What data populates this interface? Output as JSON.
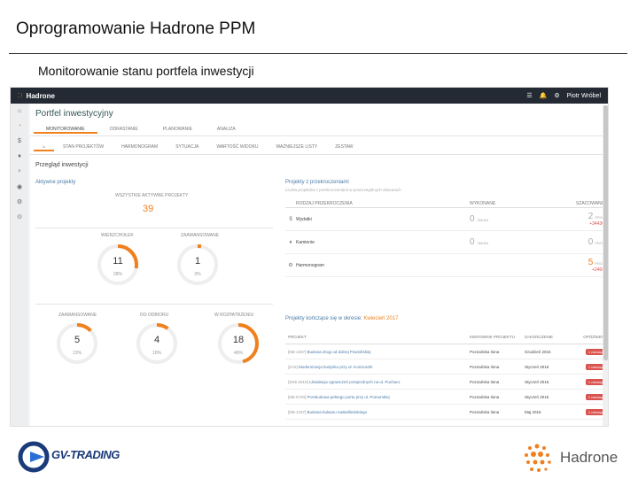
{
  "slide": {
    "title": "Oprogramowanie Hadrone PPM",
    "subtitle": "Monitorowanie stanu portfela inwestycji"
  },
  "app": {
    "brand": "Hadrone",
    "user": "Piotr Wróbel"
  },
  "page": {
    "title": "Portfel inwestycyjny",
    "tabs": [
      {
        "label": "MONITOROWANIE",
        "active": true
      },
      {
        "label": "ODRASTANIE",
        "active": false
      },
      {
        "label": "PLANOWANIE",
        "active": false
      },
      {
        "label": "ANALIZA",
        "active": false
      }
    ],
    "subtabs": [
      {
        "label": "",
        "home": true
      },
      {
        "label": "STAN PROJEKTÓW"
      },
      {
        "label": "HARMONOGRAM"
      },
      {
        "label": "SYTUACJA"
      },
      {
        "label": "WARTOŚĆ WIDOKU"
      },
      {
        "label": "WAŻNIEJSZE LISTY"
      },
      {
        "label": "ZESTAW"
      }
    ],
    "section_title": "Przegląd inwestycji"
  },
  "active_projects": {
    "heading": "Aktywne projekty",
    "total_label": "WSZYSTKIE AKTYWNE PROJEKTY",
    "total": "39",
    "groups": [
      {
        "label": "WIERZCHOŁEK",
        "value": "11",
        "pct": "28%",
        "fraction": 0.28
      },
      {
        "label": "ZAAWANSOWANE",
        "value": "1",
        "pct": "3%",
        "fraction": 0.03
      },
      {
        "label": "ZAAWANSOWANE",
        "value": "5",
        "pct": "13%",
        "fraction": 0.13
      },
      {
        "label": "DO ODBIORU",
        "value": "4",
        "pct": "10%",
        "fraction": 0.1
      },
      {
        "label": "W ROZPATRZENIU",
        "value": "18",
        "pct": "46%",
        "fraction": 0.46
      }
    ]
  },
  "overdue": {
    "heading": "Projekty z przekroczeniami",
    "subheading": "Liczba projektów z przekroczeniami w poszczególnych obszarach",
    "columns": [
      "RODZAJ PRZEKROCZENIA",
      "WYKONANE",
      "SZACOWANE"
    ],
    "rows": [
      {
        "icon": "$",
        "name": "Wydatki",
        "done": "0",
        "done_unit": "ZMIAN",
        "plan": "2",
        "plan_unit": "PROJ",
        "plan_highlight": false,
        "delta": "+34436"
      },
      {
        "icon": "♦",
        "name": "Kamienie",
        "done": "0",
        "done_unit": "ZMIAN",
        "plan": "0",
        "plan_unit": "PROJ",
        "plan_highlight": false,
        "delta": ""
      },
      {
        "icon": "⚙",
        "name": "Harmonogram",
        "done": "",
        "done_unit": "",
        "plan": "5",
        "plan_unit": "PROJ",
        "plan_highlight": true,
        "delta": "+2460"
      }
    ]
  },
  "closing": {
    "heading": "Projekty kończące się w okresie:",
    "period": "Kwiecień 2017",
    "columns": [
      "PROJEKT",
      "KIEROWNIK PROJEKTU",
      "ZAKOŃCZENIE",
      "OPÓŹNIENIE"
    ],
    "rows": [
      {
        "code": "[NB-1257]",
        "name": "Budowa drogi od dolnej Powsińskiej",
        "manager": "Poznańska Ilona",
        "date": "Grudzień 2015",
        "badge": "1 miesiące"
      },
      {
        "code": "[ZA5]",
        "name": "Modernizacja budynku przy ul. Kościuszki",
        "manager": "Poznańska Ilona",
        "date": "Styczeń 2016",
        "badge": "1 miesiące"
      },
      {
        "code": "[SN6-2018]",
        "name": "Likwidacja ograniczeń przejezdnych na ul. Puchacz",
        "manager": "Poznańska Ilona",
        "date": "Styczeń 2016",
        "badge": "1 miesiące"
      },
      {
        "code": "[NB-5720]",
        "name": "Przebudowa pełnego portu przy ul. Pomorskiej",
        "manager": "Poznańska Ilona",
        "date": "Styczeń 2016",
        "badge": "1 miesiące"
      },
      {
        "code": "[NB-1237]",
        "name": "Budowa bulwaru nadwiślańskiego",
        "manager": "Poznańska Ilona",
        "date": "Maj 2016",
        "badge": "1 miesiące"
      }
    ]
  },
  "footer": {
    "left_logo": "GV-TRADING",
    "right_logo": "Hadrone"
  },
  "colors": {
    "accent": "#f0801e",
    "topbar": "#232a33",
    "link": "#4a7aa8",
    "danger": "#d9534f"
  }
}
